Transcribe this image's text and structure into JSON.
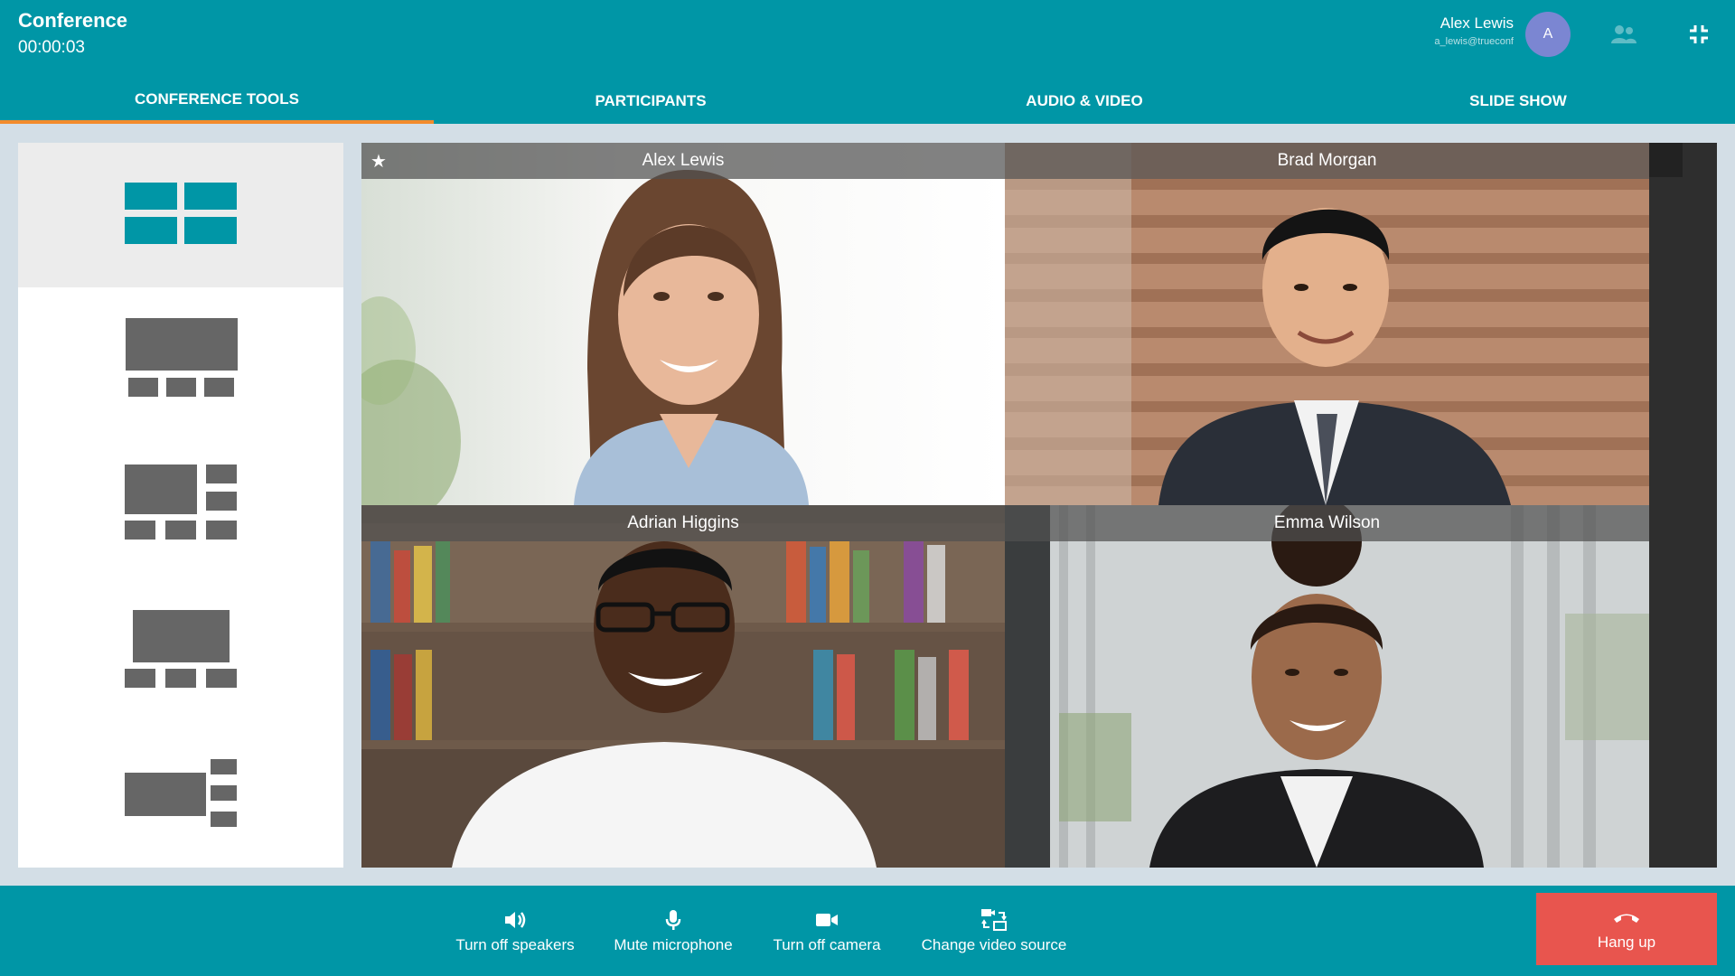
{
  "header": {
    "title": "Conference",
    "timer": "00:00:03",
    "user_name": "Alex Lewis",
    "user_email": "a_lewis@trueconf",
    "avatar_initial": "A",
    "icons": [
      "participants-icon",
      "exit-fullscreen-icon"
    ]
  },
  "tabs": [
    {
      "label": "CONFERENCE TOOLS",
      "active": true
    },
    {
      "label": "PARTICIPANTS",
      "active": false
    },
    {
      "label": "AUDIO & VIDEO",
      "active": false
    },
    {
      "label": "SLIDE SHOW",
      "active": false
    }
  ],
  "layouts": {
    "options": [
      "grid-2x2",
      "large-top-strip-bottom",
      "large-left-side-right",
      "centered-strip-bottom",
      "wide-left-stack-right"
    ],
    "selected": "grid-2x2"
  },
  "video": {
    "tiles": [
      {
        "name": "Alex Lewis",
        "starred": true
      },
      {
        "name": "Brad Morgan",
        "starred": false
      },
      {
        "name": "Adrian Higgins",
        "starred": false
      },
      {
        "name": "Emma Wilson",
        "starred": false
      }
    ]
  },
  "toolbar": {
    "speakers_label": "Turn off speakers",
    "microphone_label": "Mute microphone",
    "camera_label": "Turn off camera",
    "video_source_label": "Change video source",
    "hangup_label": "Hang up"
  },
  "colors": {
    "brand": "#0096a6",
    "active_tab_underline": "#f28b2c",
    "hangup": "#e8554e",
    "avatar": "#7b86d2"
  }
}
